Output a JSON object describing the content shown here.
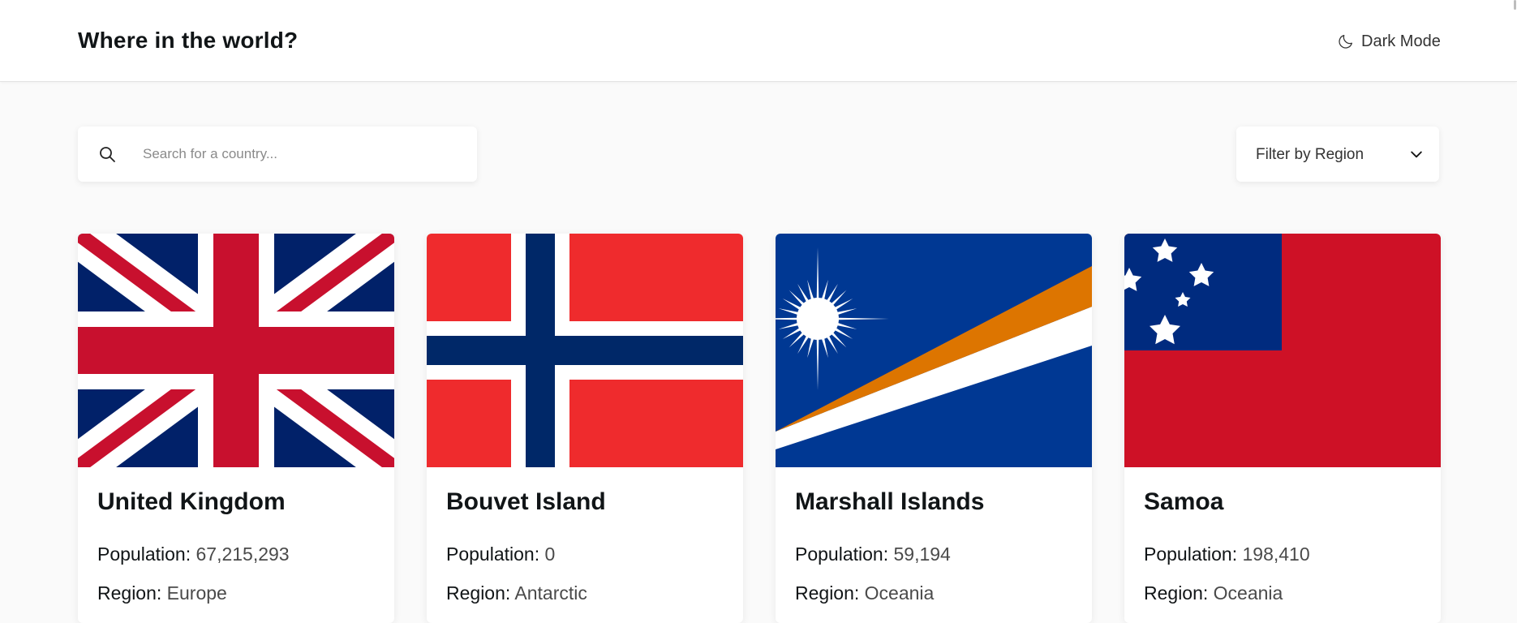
{
  "header": {
    "title": "Where in the world?",
    "theme_toggle_label": "Dark Mode",
    "theme_icon": "moon-icon"
  },
  "search": {
    "placeholder": "Search for a country...",
    "value": "",
    "icon": "search-icon"
  },
  "filter": {
    "label": "Filter by Region",
    "icon": "chevron-down-icon"
  },
  "labels": {
    "population": "Population:",
    "region": "Region:"
  },
  "countries": [
    {
      "name": "United Kingdom",
      "population": "67,215,293",
      "region": "Europe",
      "flag": "uk-flag"
    },
    {
      "name": "Bouvet Island",
      "population": "0",
      "region": "Antarctic",
      "flag": "bouvet-flag"
    },
    {
      "name": "Marshall Islands",
      "population": "59,194",
      "region": "Oceania",
      "flag": "marshall-islands-flag"
    },
    {
      "name": "Samoa",
      "population": "198,410",
      "region": "Oceania",
      "flag": "samoa-flag"
    }
  ],
  "colors": {
    "background": "#fafafa",
    "surface": "#ffffff",
    "text": "#111517"
  }
}
